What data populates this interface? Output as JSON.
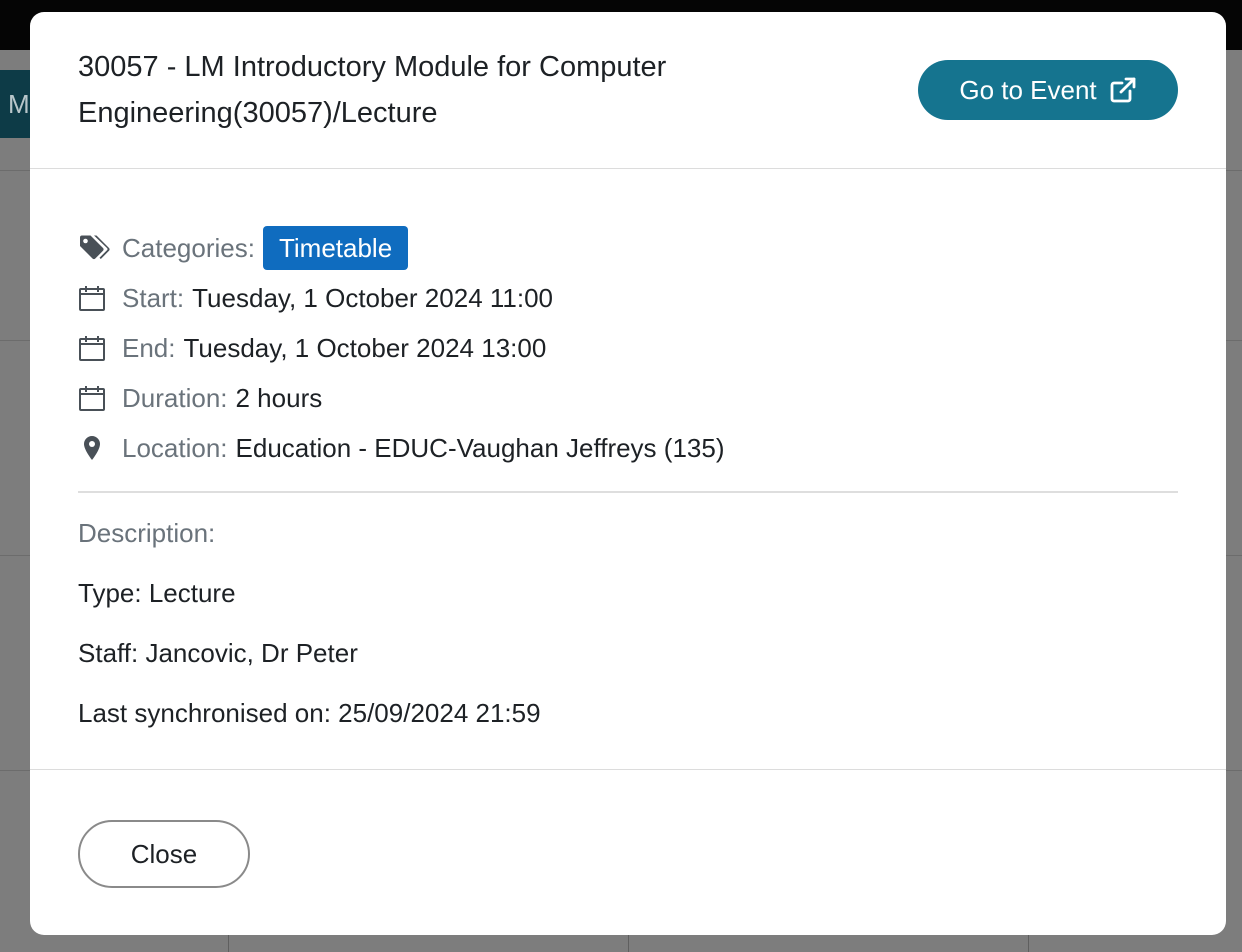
{
  "background": {
    "tab_label": "M"
  },
  "modal": {
    "title": "30057 - LM Introductory Module for Computer Engineering(30057)/Lecture",
    "go_to_event_label": "Go to Event",
    "categories": {
      "label": "Categories:",
      "value": "Timetable",
      "icon": "tags-icon"
    },
    "start": {
      "label": "Start:",
      "value": "Tuesday, 1 October 2024 11:00",
      "icon": "calendar-icon"
    },
    "end": {
      "label": "End:",
      "value": "Tuesday, 1 October 2024 13:00",
      "icon": "calendar-icon"
    },
    "duration": {
      "label": "Duration:",
      "value": "2 hours",
      "icon": "calendar-icon"
    },
    "location": {
      "label": "Location:",
      "value": "Education - EDUC-Vaughan Jeffreys (135)",
      "icon": "map-marker-icon"
    },
    "description": {
      "label": "Description:",
      "lines": [
        "Type: Lecture",
        "Staff: Jancovic, Dr Peter",
        "Last synchronised on: 25/09/2024 21:59"
      ]
    },
    "close_label": "Close"
  },
  "colors": {
    "primary_button": "#15748f",
    "badge": "#0f6cbf",
    "overlay": "#7d7d7d"
  }
}
